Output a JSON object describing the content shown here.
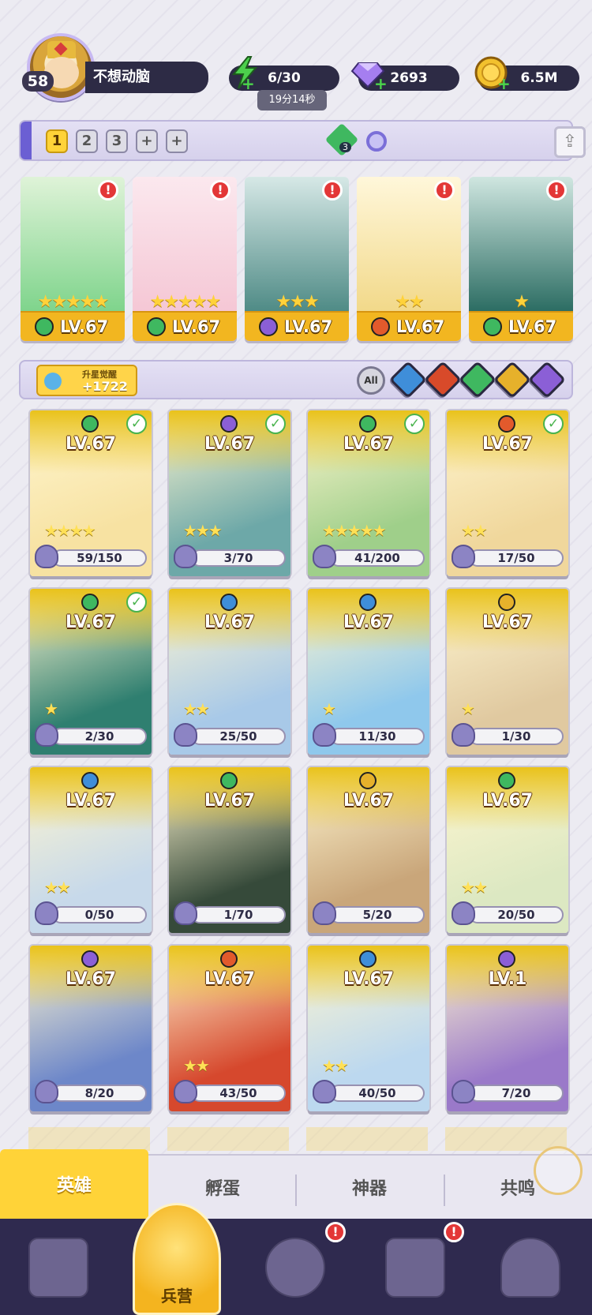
{
  "player": {
    "level": "58",
    "name": "不想动脑"
  },
  "resources": {
    "energy": "6/30",
    "energy_timer": "19分14秒",
    "gems": "2693",
    "gold": "6.5M"
  },
  "team_bar": {
    "tabs": [
      "1",
      "2",
      "3",
      "+",
      "+"
    ],
    "active_tab": "1",
    "gem_badge": "3"
  },
  "team": [
    {
      "level": "LV.67",
      "stars": "★★★★★",
      "element_color": "#3fb860",
      "art": "#7fd48c",
      "alert": "!"
    },
    {
      "level": "LV.67",
      "stars": "★★★★★",
      "element_color": "#3fb860",
      "art": "#f5c7d5",
      "alert": "!"
    },
    {
      "level": "LV.67",
      "stars": "★★★",
      "element_color": "#8b5fd6",
      "art": "#4f8b86",
      "alert": "!"
    },
    {
      "level": "LV.67",
      "stars": "★★",
      "element_color": "#e25a2c",
      "art": "#f2d98a",
      "alert": "!"
    },
    {
      "level": "LV.67",
      "stars": "★",
      "element_color": "#3fb860",
      "art": "#2c6d63",
      "alert": "!"
    }
  ],
  "filter": {
    "awaken_title": "升星觉醒",
    "awaken_value": "+1722",
    "all_label": "All",
    "colors": [
      "#3f8ed9",
      "#d84a2a",
      "#3fb860",
      "#e6b12b",
      "#8b5fd6"
    ]
  },
  "heroes": [
    {
      "level": "LV.67",
      "progress": "59/150",
      "element_color": "#3fb860",
      "checked": true,
      "stars": "★★★★",
      "art": "#f7e2a2"
    },
    {
      "level": "LV.67",
      "progress": "3/70",
      "element_color": "#8b5fd6",
      "checked": true,
      "stars": "★★★",
      "art": "#6da8a8"
    },
    {
      "level": "LV.67",
      "progress": "41/200",
      "element_color": "#3fb860",
      "checked": true,
      "stars": "★★★★★",
      "art": "#9fcf8a"
    },
    {
      "level": "LV.67",
      "progress": "17/50",
      "element_color": "#e25a2c",
      "checked": true,
      "stars": "★★",
      "art": "#f0d79c"
    },
    {
      "level": "LV.67",
      "progress": "2/30",
      "element_color": "#3fb860",
      "checked": true,
      "stars": "★",
      "art": "#2f7f70"
    },
    {
      "level": "LV.67",
      "progress": "25/50",
      "element_color": "#3f8ed9",
      "checked": false,
      "stars": "★★",
      "art": "#a8c9e8"
    },
    {
      "level": "LV.67",
      "progress": "11/30",
      "element_color": "#3f8ed9",
      "checked": false,
      "stars": "★",
      "art": "#8fc8ec"
    },
    {
      "level": "LV.67",
      "progress": "1/30",
      "element_color": "#e6b12b",
      "checked": false,
      "stars": "★",
      "art": "#e0c9a0"
    },
    {
      "level": "LV.67",
      "progress": "0/50",
      "element_color": "#3f8ed9",
      "checked": false,
      "stars": "★★",
      "art": "#c7d9ea"
    },
    {
      "level": "LV.67",
      "progress": "1/70",
      "element_color": "#3fb860",
      "checked": false,
      "stars": "",
      "art": "#364a3a"
    },
    {
      "level": "LV.67",
      "progress": "5/20",
      "element_color": "#e6b12b",
      "checked": false,
      "stars": "",
      "art": "#c9a67a"
    },
    {
      "level": "LV.67",
      "progress": "20/50",
      "element_color": "#3fb860",
      "checked": false,
      "stars": "★★",
      "art": "#dce8c2"
    },
    {
      "level": "LV.67",
      "progress": "8/20",
      "element_color": "#8b5fd6",
      "checked": false,
      "stars": "",
      "art": "#6d87c9"
    },
    {
      "level": "LV.67",
      "progress": "43/50",
      "element_color": "#e25a2c",
      "checked": false,
      "stars": "★★",
      "art": "#d6482d"
    },
    {
      "level": "LV.67",
      "progress": "40/50",
      "element_color": "#3f8ed9",
      "checked": false,
      "stars": "★★",
      "art": "#bcd8ef"
    },
    {
      "level": "LV.1",
      "progress": "7/20",
      "element_color": "#8b5fd6",
      "checked": false,
      "stars": "",
      "art": "#9a79c9"
    }
  ],
  "subtabs": [
    "英雄",
    "孵蛋",
    "神器",
    "共鸣"
  ],
  "active_subtab": "英雄",
  "bottom_nav": {
    "active_label": "兵营",
    "alert": "!"
  }
}
